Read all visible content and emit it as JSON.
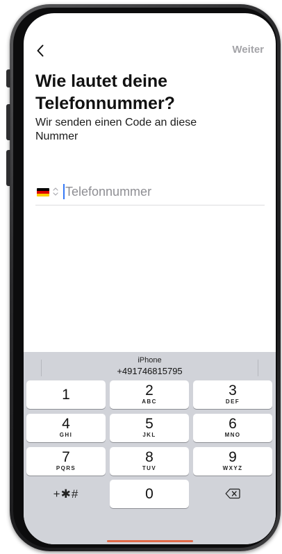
{
  "nav": {
    "back_icon": "chevron-left-icon",
    "next_label": "Weiter"
  },
  "heading": {
    "title": "Wie lautet deine Telefonnummer?",
    "subtitle": "Wir senden einen Code an diese Nummer"
  },
  "phone_field": {
    "country_flag": "germany-flag-icon",
    "flag_colors": [
      "#000000",
      "#dd0000",
      "#ffce00"
    ],
    "country_picker_icon": "chevron-up-down-icon",
    "value": "",
    "placeholder": "Telefonnummer"
  },
  "keyboard": {
    "suggestion": {
      "label": "iPhone",
      "number": "+491746815795"
    },
    "keys": [
      {
        "digit": "1",
        "letters": ""
      },
      {
        "digit": "2",
        "letters": "ABC"
      },
      {
        "digit": "3",
        "letters": "DEF"
      },
      {
        "digit": "4",
        "letters": "GHI"
      },
      {
        "digit": "5",
        "letters": "JKL"
      },
      {
        "digit": "6",
        "letters": "MNO"
      },
      {
        "digit": "7",
        "letters": "PQRS"
      },
      {
        "digit": "8",
        "letters": "TUV"
      },
      {
        "digit": "9",
        "letters": "WXYZ"
      },
      {
        "digit": "0",
        "letters": ""
      }
    ],
    "symbols_label": "+✱#",
    "delete_icon": "backspace-icon"
  }
}
